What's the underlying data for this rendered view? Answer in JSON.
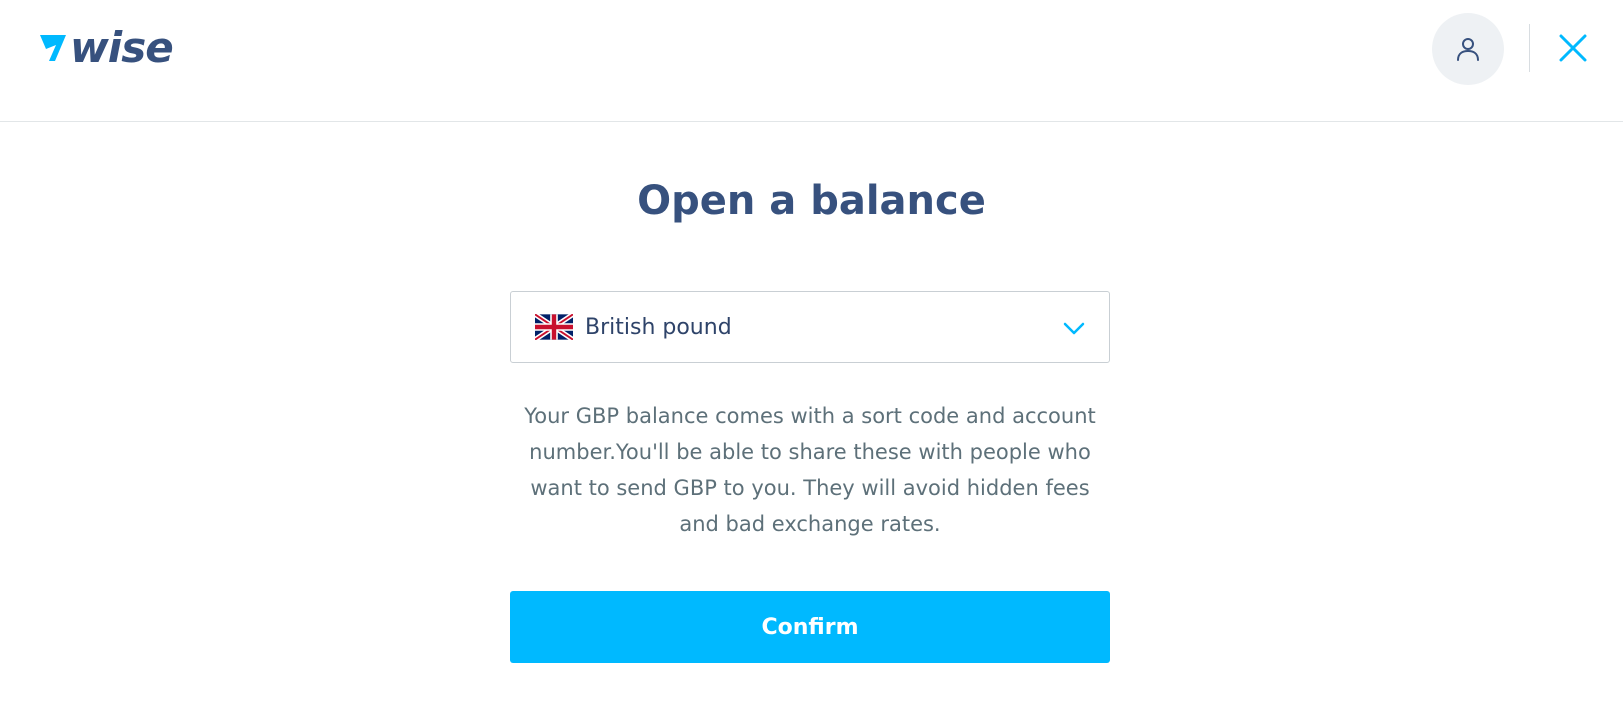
{
  "header": {
    "logo_text": "wise",
    "logo_icon": "wise-flag-icon",
    "profile_icon": "user-icon",
    "close_icon": "close-icon"
  },
  "main": {
    "title": "Open a balance",
    "currency_select": {
      "selected": "British pound",
      "flag_icon": "uk-flag-icon",
      "chevron_icon": "chevron-down-icon"
    },
    "description": "Your GBP balance comes with a sort code and account number.You'll be able to share these with people who want to send GBP to you. They will avoid hidden fees and bad exchange rates.",
    "confirm_label": "Confirm"
  },
  "colors": {
    "brand_navy": "#37517e",
    "accent_blue": "#00b9ff",
    "text_gray": "#5d7079",
    "border": "#e2e6e8"
  }
}
